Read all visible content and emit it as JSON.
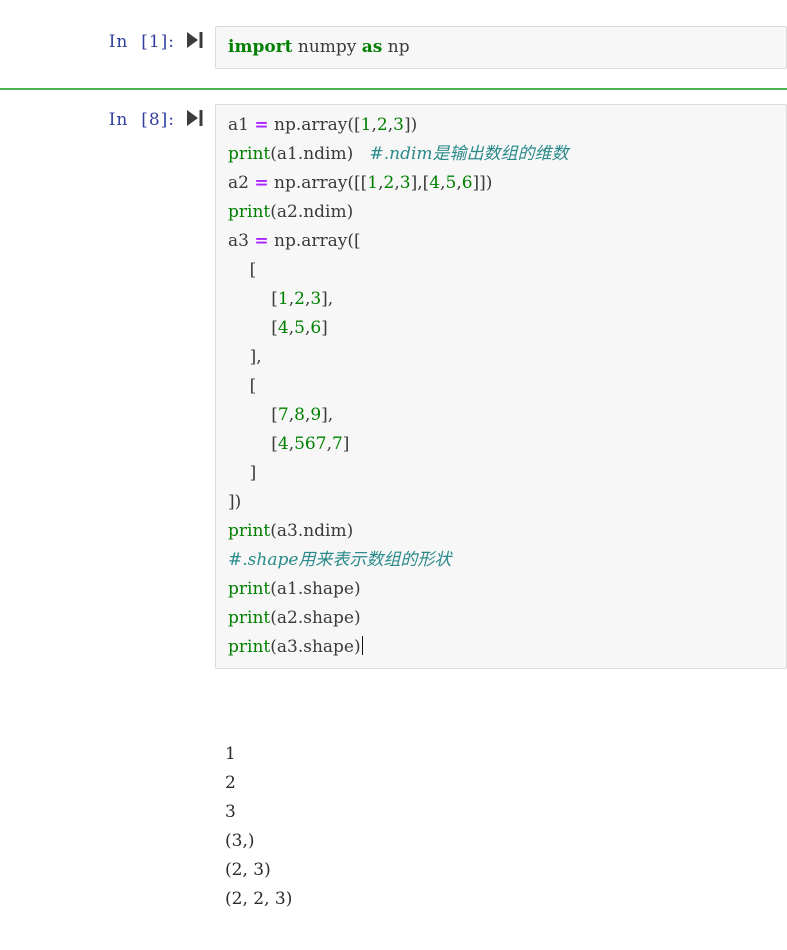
{
  "notebook": {
    "separator_color": "#4caf50",
    "cell_bg": "#f7f7f7",
    "cell_border": "#dcdcdc",
    "prompt_color": "#303f9f"
  },
  "cells": [
    {
      "prompt": "In  [1]:",
      "run_icon": "run-cell-icon",
      "code_plain": "import numpy as np"
    },
    {
      "prompt": "In  [8]:",
      "run_icon": "run-cell-icon",
      "code_plain": "a1 = np.array([1,2,3])\nprint(a1.ndim)   #.ndim是输出数组的维数\na2 = np.array([[1,2,3],[4,5,6]])\nprint(a2.ndim)\na3 = np.array([\n    [\n        [1,2,3],\n        [4,5,6]\n    ],\n    [\n        [7,8,9],\n        [4,567,7]\n    ]\n])\nprint(a3.ndim)\n#.shape用来表示数组的形状\nprint(a1.shape)\nprint(a2.shape)\nprint(a3.shape)"
    }
  ],
  "code_tokens": {
    "cell1": {
      "kw_import": "import",
      "name_numpy": " numpy ",
      "kw_as": "as",
      "name_np": " np"
    },
    "cell2": {
      "l1_a1": "a1 ",
      "l1_eq": "=",
      "l1_nparray": " np.array([",
      "l1_n1": "1",
      "l1_c1": ",",
      "l1_n2": "2",
      "l1_c2": ",",
      "l1_n3": "3",
      "l1_end": "])",
      "l2_print": "print",
      "l2_args": "(a1.ndim)",
      "l2_gap": "   ",
      "l2_comment": "#.ndim是输出数组的维数",
      "l3_a2": "a2 ",
      "l3_eq": "=",
      "l3_open": " np.array([[",
      "l3_n1": "1",
      "l3_c1": ",",
      "l3_n2": "2",
      "l3_c2": ",",
      "l3_n3": "3",
      "l3_mid": "],[",
      "l3_n4": "4",
      "l3_c3": ",",
      "l3_n5": "5",
      "l3_c4": ",",
      "l3_n6": "6",
      "l3_end": "]])",
      "l4_print": "print",
      "l4_args": "(a2.ndim)",
      "l5_a3": "a3 ",
      "l5_eq": "=",
      "l5_open": " np.array([",
      "l6_bracket": "    [",
      "l7_indent": "        [",
      "l7_n1": "1",
      "l7_c1": ",",
      "l7_n2": "2",
      "l7_c2": ",",
      "l7_n3": "3",
      "l7_end": "],",
      "l8_indent": "        [",
      "l8_n1": "4",
      "l8_c1": ",",
      "l8_n2": "5",
      "l8_c2": ",",
      "l8_n3": "6",
      "l8_end": "]",
      "l9_close": "    ],",
      "l10_bracket": "    [",
      "l11_indent": "        [",
      "l11_n1": "7",
      "l11_c1": ",",
      "l11_n2": "8",
      "l11_c2": ",",
      "l11_n3": "9",
      "l11_end": "],",
      "l12_indent": "        [",
      "l12_n1": "4",
      "l12_c1": ",",
      "l12_n2": "567",
      "l12_c2": ",",
      "l12_n3": "7",
      "l12_end": "]",
      "l13_close": "    ]",
      "l14_close": "])",
      "l15_print": "print",
      "l15_args": "(a3.ndim)",
      "l16_comment": "#.shape用来表示数组的形状",
      "l17_print": "print",
      "l17_args": "(a1.shape)",
      "l18_print": "print",
      "l18_args": "(a2.shape)",
      "l19_print": "print",
      "l19_args": "(a3.shape)"
    }
  },
  "output": {
    "lines": [
      "1",
      "2",
      "3",
      "(3,)",
      "(2, 3)",
      "(2, 2, 3)"
    ],
    "text": "1\n2\n3\n(3,)\n(2, 3)\n(2, 2, 3)"
  }
}
